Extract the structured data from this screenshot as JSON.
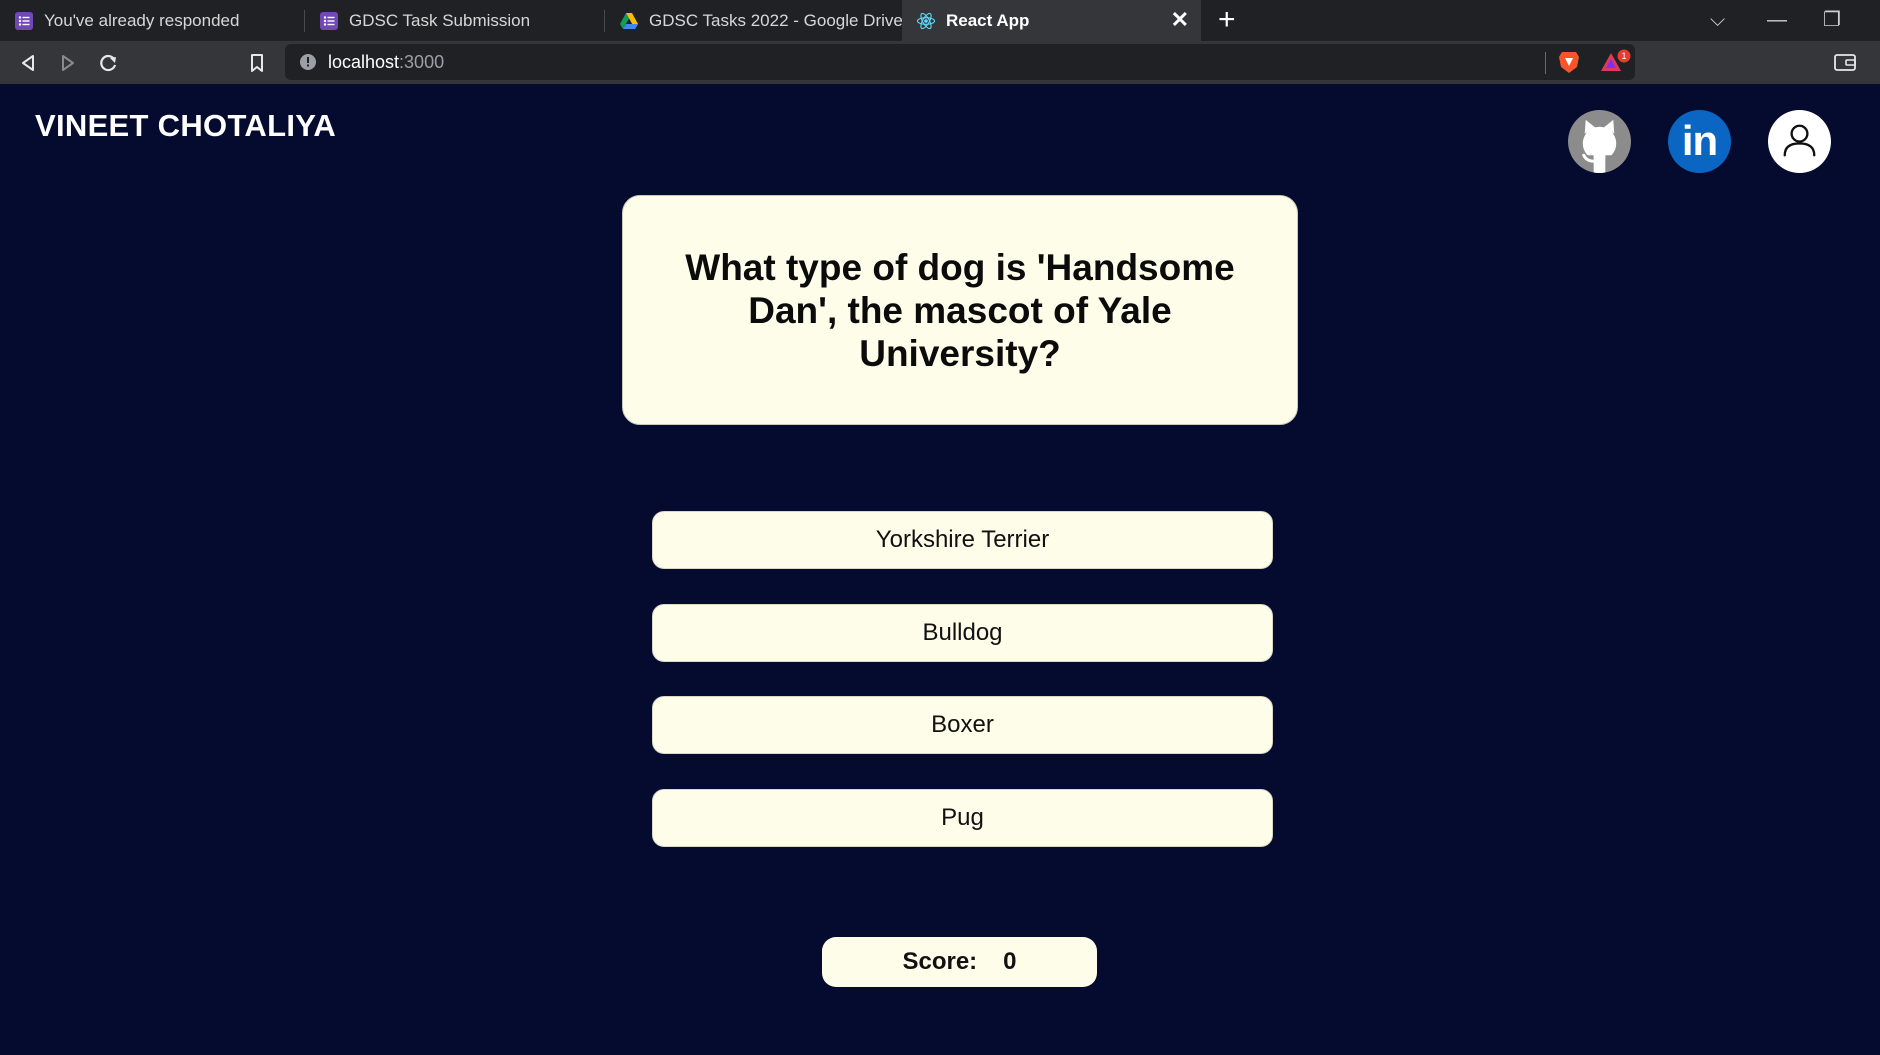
{
  "browser": {
    "tabs": [
      {
        "title": "You've already responded",
        "icon": "google-forms-icon",
        "active": false
      },
      {
        "title": "GDSC Task Submission",
        "icon": "google-forms-icon",
        "active": false
      },
      {
        "title": "GDSC Tasks 2022 - Google Drive",
        "icon": "google-drive-icon",
        "active": false
      },
      {
        "title": "React App",
        "icon": "react-icon",
        "active": true
      }
    ],
    "close_glyph": "✕",
    "newtab_glyph": "+",
    "window_controls": {
      "dropdown": "⌵",
      "minimize": "—",
      "restore": "❐"
    },
    "url_host": "localhost",
    "url_port": ":3000",
    "notification_count": "1"
  },
  "header": {
    "brand": "VINEET CHOTALIYA",
    "links": [
      {
        "icon": "github-icon"
      },
      {
        "icon": "linkedin-icon",
        "glyph": "in"
      },
      {
        "icon": "user-profile-icon"
      }
    ]
  },
  "quiz": {
    "question": "What type of dog is 'Handsome Dan', the mascot of Yale University?",
    "answers": [
      "Yorkshire Terrier",
      "Bulldog",
      "Boxer",
      "Pug"
    ],
    "score_label": "Score:",
    "score_value": "0"
  },
  "colors": {
    "page_bg": "#050a2f",
    "card_bg": "#fdfdea",
    "linkedin_blue": "#0a66c2",
    "github_gray": "#8c8c8c"
  }
}
